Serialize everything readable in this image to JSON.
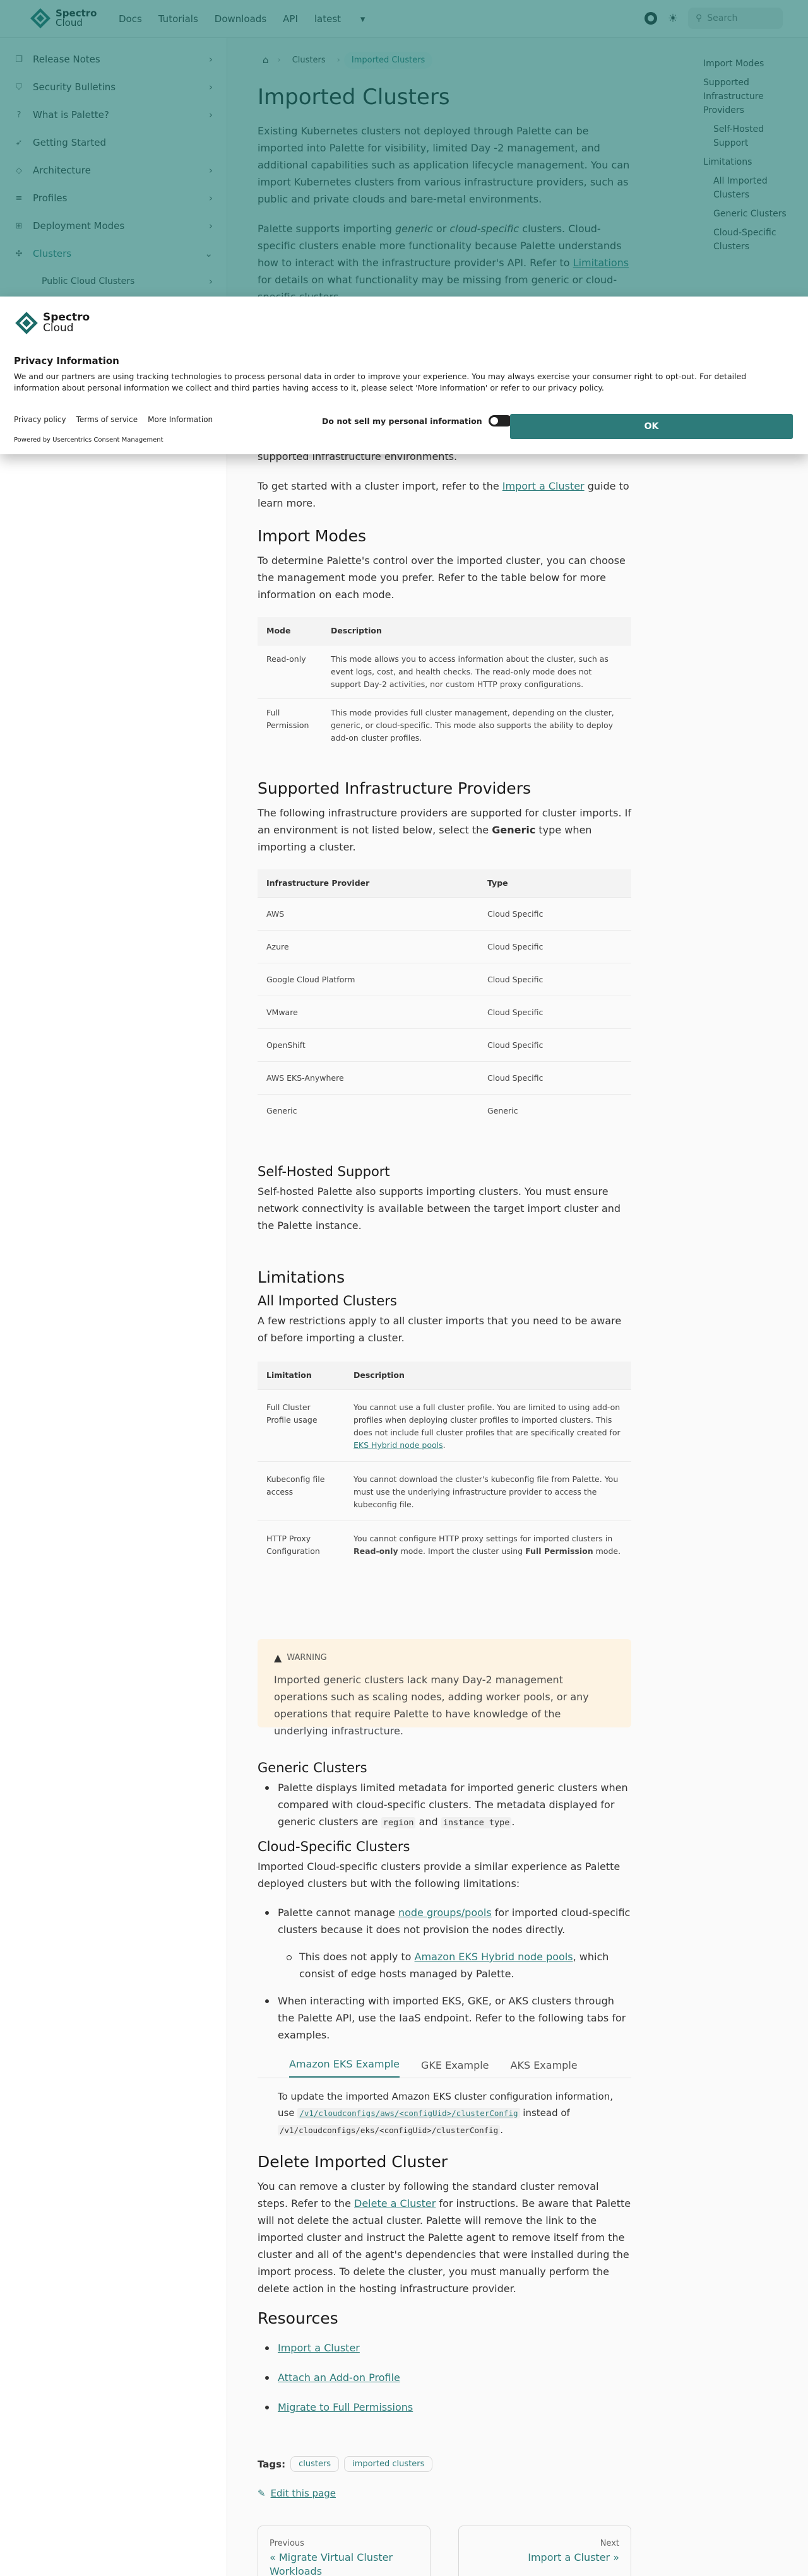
{
  "nav": {
    "brand_top": "Spectro",
    "brand_bottom": "Cloud",
    "links": [
      "Docs",
      "Tutorials",
      "Downloads",
      "API",
      "latest"
    ],
    "search_placeholder": "Search"
  },
  "sidebar": [
    {
      "label": "Release Notes",
      "icon": "bookmark-icon"
    },
    {
      "label": "Security Bulletins",
      "icon": "shield-icon"
    },
    {
      "label": "What is Palette?",
      "icon": "question-icon"
    },
    {
      "label": "Getting Started",
      "icon": "rocket-icon"
    },
    {
      "label": "Architecture",
      "icon": "cube-icon"
    },
    {
      "label": "Profiles",
      "icon": "layers-icon"
    },
    {
      "label": "Deployment Modes",
      "icon": "network-icon"
    },
    {
      "label": "Clusters",
      "icon": "cluster-icon"
    },
    {
      "label": "Public Cloud Clusters",
      "icon": ""
    }
  ],
  "breadcrumb": [
    "Clusters",
    "Imported Clusters"
  ],
  "page": {
    "title": "Imported Clusters",
    "intro1": "Existing Kubernetes clusters not deployed through Palette can be imported into Palette for visibility, limited Day -2 management, and additional capabilities such as application lifecycle management. You can import Kubernetes clusters from various infrastructure providers, such as public and private clouds and bare-metal environments.",
    "intro2a": "Palette supports importing ",
    "intro2b": "generic",
    "intro2c": " or ",
    "intro2d": "cloud-specific",
    "intro2e": " clusters. Cloud-specific clusters enable more functionality because Palette understands how to interact with the infrastructure provider's API. Refer to ",
    "intro2link": "Limitations",
    "intro2f": " for details on what functionality may be missing from generic or cloud-specific clusters.",
    "intro3": "supported infrastructure environments.",
    "intro4a": "To get started with a cluster import, refer to the ",
    "intro4link": "Import a Cluster",
    "intro4b": " guide to learn more.",
    "modes_title": "Import Modes",
    "modes_text": "To determine Palette's control over the imported cluster, you can choose the management mode you prefer. Refer to the table below for more information on each mode.",
    "modes_table": {
      "headers": [
        "Mode",
        "Description"
      ],
      "rows": [
        [
          "Read-only",
          "This mode allows you to access information about the cluster, such as event logs, cost, and health checks. The read-only mode does not support Day-2 activities, nor custom HTTP proxy configurations."
        ],
        [
          "Full Permission",
          "This mode provides full cluster management, depending on the cluster, generic, or cloud-specific. This mode also supports the ability to deploy add-on cluster profiles."
        ]
      ]
    },
    "providers_title": "Supported Infrastructure Providers",
    "providers_text_a": "The following infrastructure providers are supported for cluster imports. If an environment is not listed below, select the ",
    "providers_text_b": "Generic",
    "providers_text_c": " type when importing a cluster.",
    "providers_table": {
      "headers": [
        "Infrastructure Provider",
        "Type"
      ],
      "rows": [
        [
          "AWS",
          "Cloud Specific"
        ],
        [
          "Azure",
          "Cloud Specific"
        ],
        [
          "Google Cloud Platform",
          "Cloud Specific"
        ],
        [
          "VMware",
          "Cloud Specific"
        ],
        [
          "OpenShift",
          "Cloud Specific"
        ],
        [
          "AWS EKS-Anywhere",
          "Cloud Specific"
        ],
        [
          "Generic",
          "Generic"
        ]
      ]
    },
    "selfhosted_title": "Self-Hosted Support",
    "selfhosted_text": "Self-hosted Palette also supports importing clusters. You must ensure network connectivity is available between the target import cluster and the Palette instance.",
    "limitations_title": "Limitations",
    "all_title": "All Imported Clusters",
    "all_text": "A few restrictions apply to all cluster imports that you need to be aware of before importing a cluster.",
    "lim_table": {
      "headers": [
        "Limitation",
        "Description"
      ],
      "r1": [
        "Full Cluster Profile usage",
        "You cannot use a full cluster profile. You are limited to using add-on profiles when deploying cluster profiles to imported clusters. This does not include full cluster profiles that are specifically created for ",
        "EKS Hybrid node pools",
        "."
      ],
      "r2": [
        "Kubeconfig file access",
        "You cannot download the cluster's kubeconfig file from Palette. You must use the underlying infrastructure provider to access the kubeconfig file."
      ],
      "r3": [
        "HTTP Proxy Configuration",
        "You cannot configure HTTP proxy settings for imported clusters in ",
        "Read-only",
        " mode. Import the cluster using ",
        "Full Permission",
        " mode."
      ]
    },
    "warning_label": "WARNING",
    "warning_text": "Imported generic clusters lack many Day-2 management operations such as scaling nodes, adding worker pools, or any operations that require Palette to have knowledge of the underlying infrastructure.",
    "generic_title": "Generic Clusters",
    "generic_a": "Palette displays limited metadata for imported generic clusters when compared with cloud-specific clusters. The metadata displayed for generic clusters are ",
    "generic_code1": "region",
    "generic_b": " and ",
    "generic_code2": "instance type",
    "generic_c": ".",
    "cloud_title": "Cloud-Specific Clusters",
    "cloud_text": "Imported Cloud-specific clusters provide a similar experience as Palette deployed clusters but with the following limitations:",
    "cb1a": "Palette cannot manage ",
    "cb1link": "node groups/pools",
    "cb1b": " for imported cloud-specific clusters because it does not provision the nodes directly.",
    "cb2a": "This does not apply to ",
    "cb2link": "Amazon EKS Hybrid node pools",
    "cb2b": ", which consist of edge hosts managed by Palette.",
    "cb3": "When interacting with imported EKS, GKE, or AKS clusters through the Palette API, use the IaaS endpoint. Refer to the following tabs for examples.",
    "tabs": [
      "Amazon EKS Example",
      "GKE Example",
      "AKS Example"
    ],
    "tab_text_a": "To update the imported Amazon EKS cluster configuration information, use ",
    "tab_code1": "/v1/cloudconfigs/aws/<configUid>/clusterConfig",
    "tab_text_b": " instead of ",
    "tab_code2": "/v1/cloudconfigs/eks/<configUid>/clusterConfig",
    "tab_text_c": ".",
    "delete_title": "Delete Imported Cluster",
    "delete_a": "You can remove a cluster by following the standard cluster removal steps. Refer to the ",
    "delete_link": "Delete a Cluster",
    "delete_b": " for instructions. Be aware that Palette will not delete the actual cluster. Palette will remove the link to the imported cluster and instruct the Palette agent to remove itself from the cluster and all of the agent's dependencies that were installed during the import process. To delete the cluster, you must manually perform the delete action in the hosting infrastructure provider.",
    "resources_title": "Resources",
    "resources": [
      "Import a Cluster",
      "Attach an Add-on Profile",
      "Migrate to Full Permissions"
    ],
    "tags_label": "Tags:",
    "tags": [
      "clusters",
      "imported clusters"
    ],
    "edit": "Edit this page",
    "prev_label": "Previous",
    "prev_title": "« Migrate Virtual Cluster Workloads",
    "next_label": "Next",
    "next_title": "Import a Cluster »"
  },
  "toc": [
    "Import Modes",
    "Supported Infrastructure Providers",
    "Self-Hosted Support",
    "Limitations",
    "All Imported Clusters",
    "Generic Clusters",
    "Cloud-Specific Clusters"
  ],
  "consent": {
    "brand_top": "Spectro",
    "brand_bottom": "Cloud",
    "title": "Privacy Information",
    "text": "We and our partners are using tracking technologies to process personal data in order to improve your experience. You may always exercise your consumer right to opt-out. For detailed information about personal information we collect and third parties having access to it, please select 'More Information' or refer to our privacy policy.",
    "links": [
      "Privacy policy",
      "Terms of service",
      "More Information"
    ],
    "powered": "Powered by Usercentrics Consent Management",
    "dns": "Do not sell my personal information",
    "ok": "OK"
  },
  "colors": {
    "accent": "#2d7b7a",
    "overlay": "rgba(24,118,112,0.62)"
  }
}
